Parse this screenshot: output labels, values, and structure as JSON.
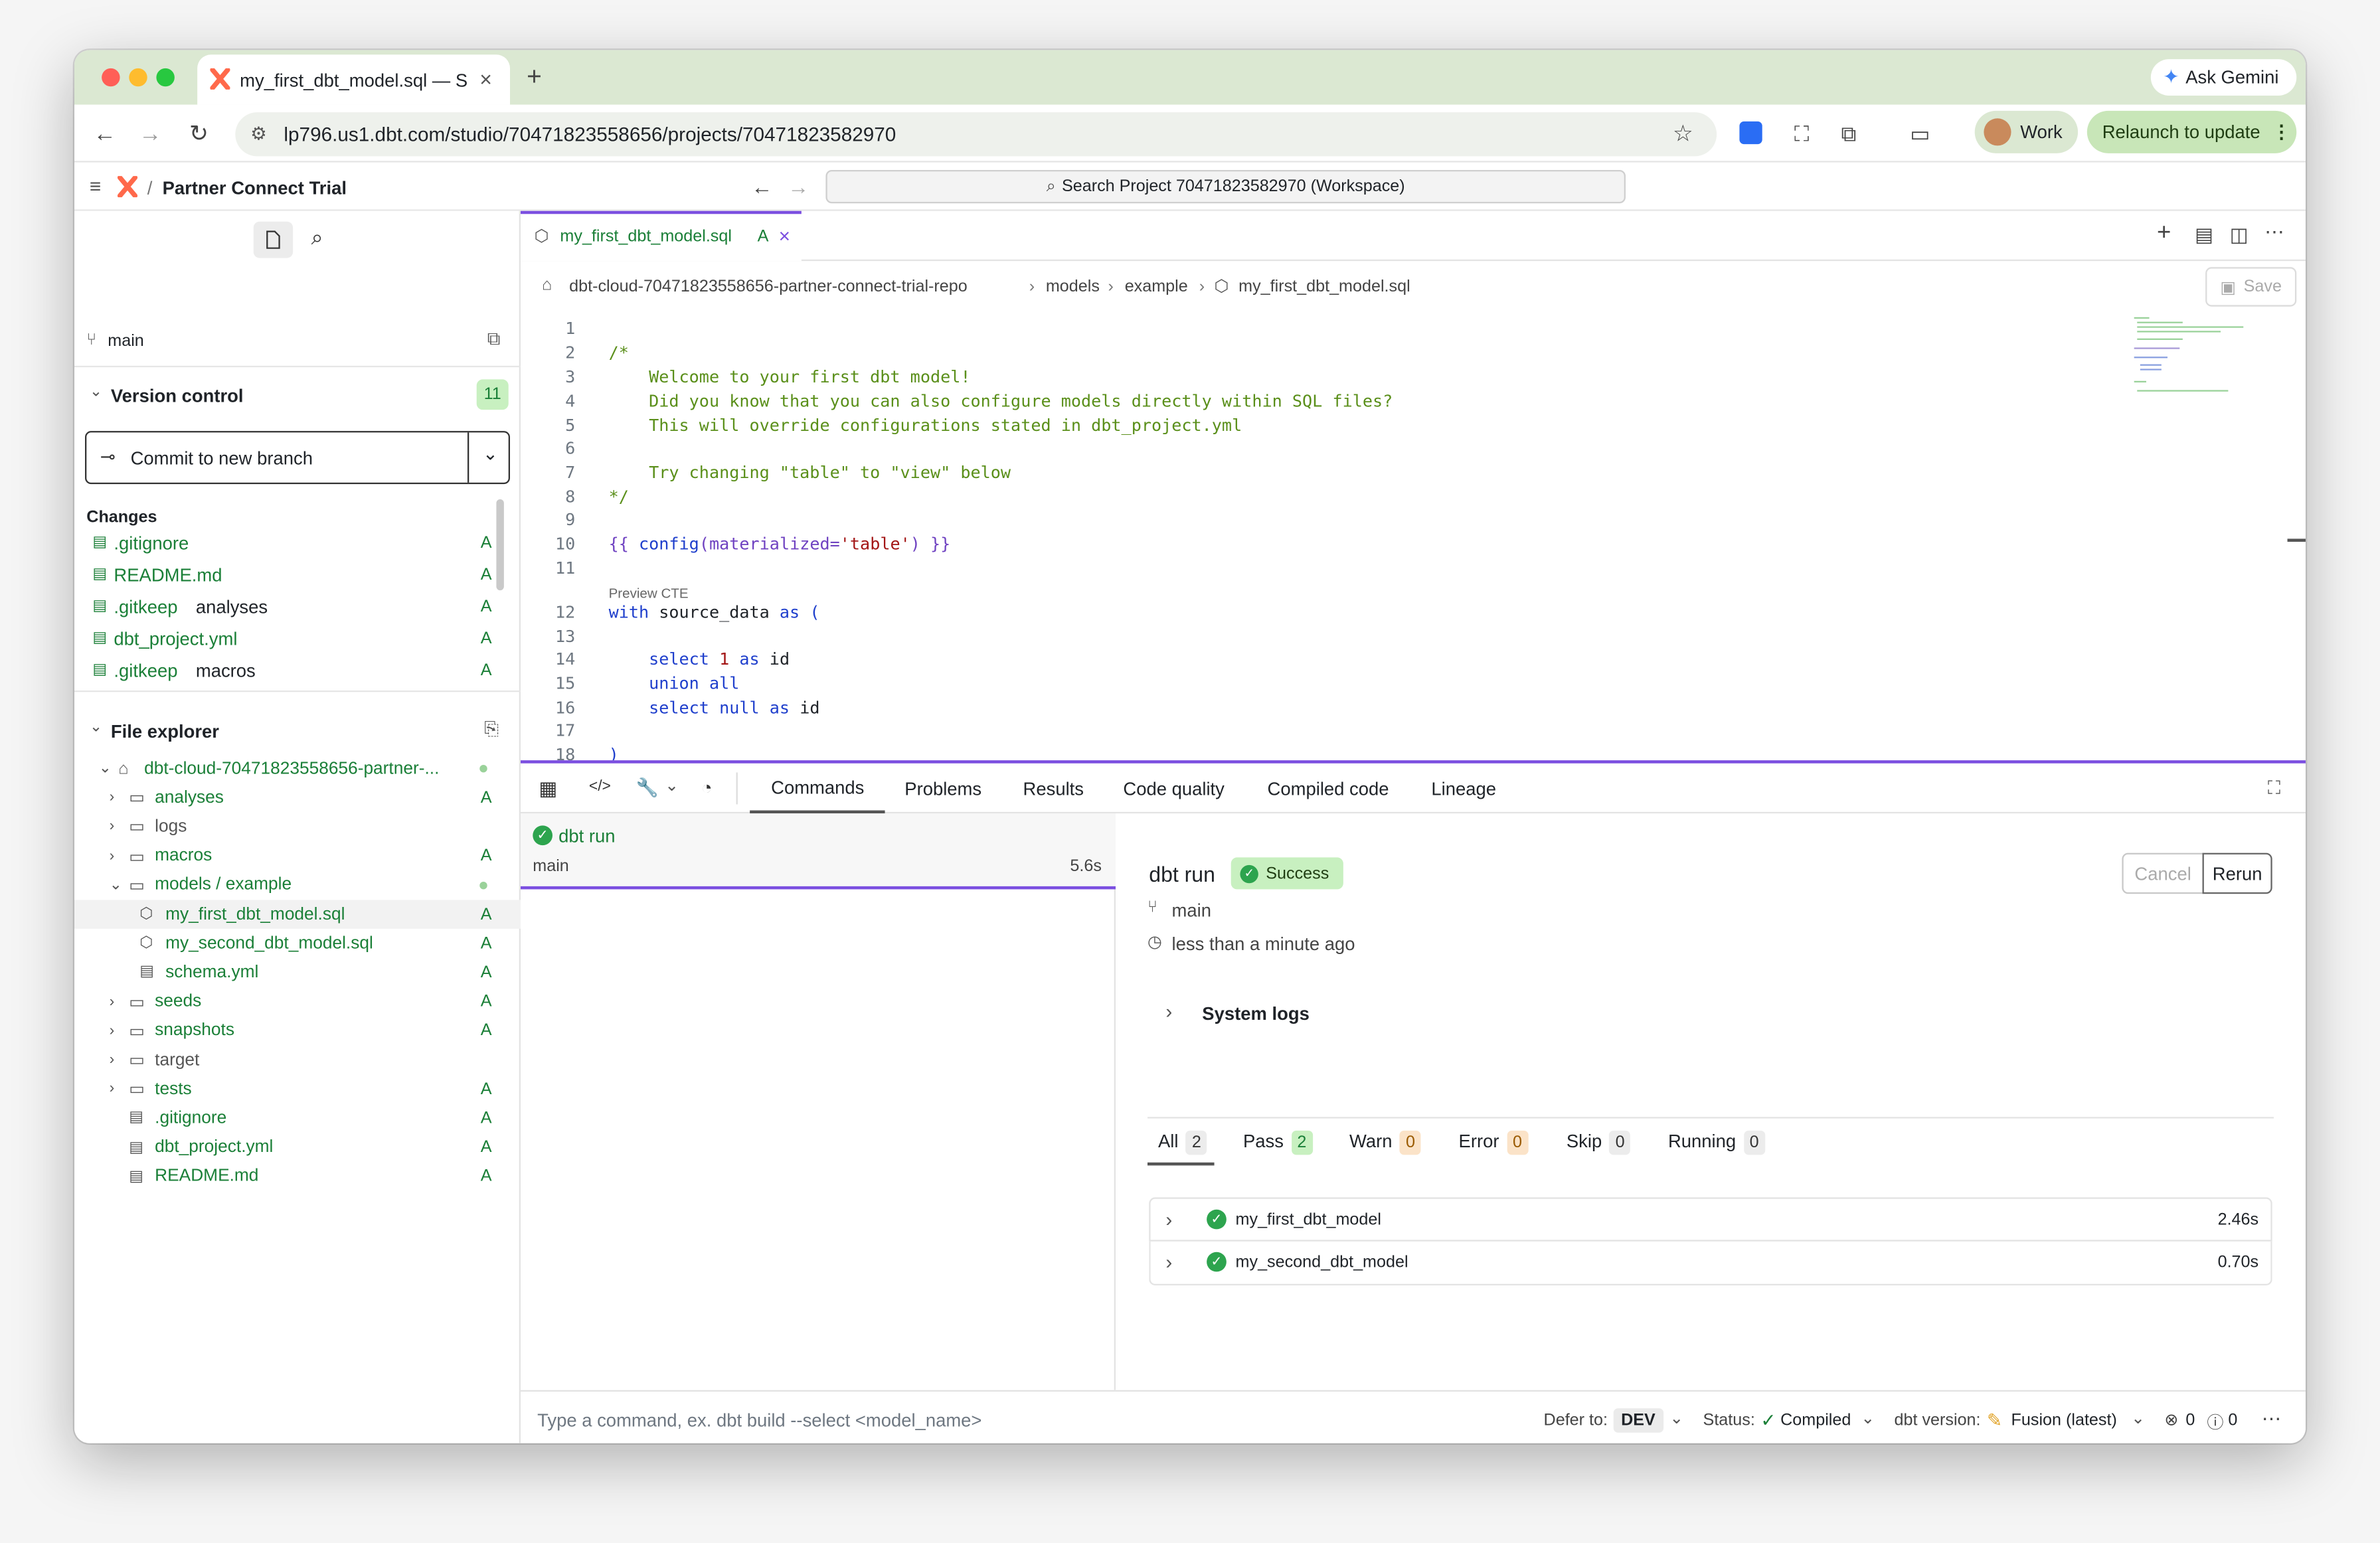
{
  "browser": {
    "tab_title": "my_first_dbt_model.sql — Se",
    "url": "lp796.us1.dbt.com/studio/70471823558656/projects/70471823582970",
    "ask_gemini": "Ask Gemini",
    "profile": "Work",
    "relaunch": "Relaunch to update"
  },
  "app": {
    "breadcrumb_sep": "/",
    "project": "Partner Connect Trial",
    "search_placeholder": "Search Project 70471823582970 (Workspace)"
  },
  "sidebar": {
    "branch": "main",
    "version_control": "Version control",
    "vc_count": "11",
    "commit_button": "Commit to new branch",
    "changes_title": "Changes",
    "changes": [
      {
        "name": ".gitignore",
        "folder": "",
        "status": "A"
      },
      {
        "name": "README.md",
        "folder": "",
        "status": "A"
      },
      {
        "name": ".gitkeep",
        "folder": "analyses",
        "status": "A"
      },
      {
        "name": "dbt_project.yml",
        "folder": "",
        "status": "A"
      },
      {
        "name": ".gitkeep",
        "folder": "macros",
        "status": "A"
      }
    ],
    "file_explorer": "File explorer",
    "tree": [
      {
        "label": "dbt-cloud-70471823558656-partner-...",
        "status": "dot"
      },
      {
        "label": "analyses",
        "status": "A"
      },
      {
        "label": "logs",
        "status": ""
      },
      {
        "label": "macros",
        "status": "A"
      },
      {
        "label": "models / example",
        "status": "dot"
      },
      {
        "label": "my_first_dbt_model.sql",
        "status": "A"
      },
      {
        "label": "my_second_dbt_model.sql",
        "status": "A"
      },
      {
        "label": "schema.yml",
        "status": "A"
      },
      {
        "label": "seeds",
        "status": "A"
      },
      {
        "label": "snapshots",
        "status": "A"
      },
      {
        "label": "target",
        "status": ""
      },
      {
        "label": "tests",
        "status": "A"
      },
      {
        "label": ".gitignore",
        "status": "A"
      },
      {
        "label": "dbt_project.yml",
        "status": "A"
      },
      {
        "label": "README.md",
        "status": "A"
      }
    ]
  },
  "editor": {
    "tab_name": "my_first_dbt_model.sql",
    "tab_status": "A",
    "path": [
      "dbt-cloud-70471823558656-partner-connect-trial-repo",
      "models",
      "example",
      "my_first_dbt_model.sql"
    ],
    "save": "Save",
    "preview_cte": "Preview CTE",
    "line_numbers": [
      "1",
      "2",
      "3",
      "4",
      "5",
      "6",
      "7",
      "8",
      "9",
      "10",
      "11",
      "12",
      "13",
      "14",
      "15",
      "16",
      "17",
      "18"
    ],
    "lines": {
      "l2": "/*",
      "l3": "    Welcome to your first dbt model!",
      "l4": "    Did you know that you can also configure models directly within SQL files?",
      "l5": "    This will override configurations stated in dbt_project.yml",
      "l7": "    Try changing \"table\" to \"view\" below",
      "l8": "*/",
      "l10_a": "{{ ",
      "l10_b": "config",
      "l10_c": "(materialized=",
      "l10_d": "'table'",
      "l10_e": ") }}",
      "l12_a": "with",
      "l12_b": " source_data ",
      "l12_c": "as",
      "l12_d": " (",
      "l14_a": "    select ",
      "l14_b": "1",
      "l14_c": " as",
      "l14_d": " id",
      "l15": "    union all",
      "l16_a": "    select null as",
      "l16_b": " id",
      "l18": ")"
    }
  },
  "panel": {
    "tabs": [
      "Commands",
      "Problems",
      "Results",
      "Code quality",
      "Compiled code",
      "Lineage"
    ],
    "history": {
      "cmd": "dbt run",
      "branch": "main",
      "duration": "5.6s"
    },
    "detail": {
      "title": "dbt run",
      "status": "Success",
      "branch": "main",
      "time": "less than a minute ago",
      "cancel": "Cancel",
      "rerun": "Rerun",
      "system_logs": "System logs",
      "filters": [
        {
          "label": "All",
          "count": "2"
        },
        {
          "label": "Pass",
          "count": "2"
        },
        {
          "label": "Warn",
          "count": "0"
        },
        {
          "label": "Error",
          "count": "0"
        },
        {
          "label": "Skip",
          "count": "0"
        },
        {
          "label": "Running",
          "count": "0"
        }
      ],
      "results": [
        {
          "name": "my_first_dbt_model",
          "time": "2.46s"
        },
        {
          "name": "my_second_dbt_model",
          "time": "0.70s"
        }
      ]
    }
  },
  "statusbar": {
    "command_placeholder": "Type a command, ex. dbt build --select <model_name>",
    "defer_label": "Defer to:",
    "defer_value": "DEV",
    "status_label": "Status:",
    "status_value": "Compiled",
    "version_label": "dbt version:",
    "version_value": "Fusion (latest)",
    "errors": "0",
    "warnings": "0"
  },
  "colors": {
    "accent_purple": "#7b4fe0",
    "success_green": "#1a7f37",
    "dbt_orange": "#ff694b"
  }
}
